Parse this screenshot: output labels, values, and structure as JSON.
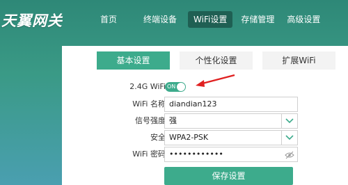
{
  "brand": {
    "logo_text": "天翼网关"
  },
  "nav": {
    "items": [
      {
        "label": "首页"
      },
      {
        "label": "终端设备"
      },
      {
        "label": "WiFi设置"
      },
      {
        "label": "存储管理"
      },
      {
        "label": "高级设置"
      }
    ],
    "active_index": 2
  },
  "tabs": [
    {
      "label": "基本设置"
    },
    {
      "label": "个性化设置"
    },
    {
      "label": "扩展WiFi"
    }
  ],
  "form": {
    "wifi_24g": {
      "label": "2.4G WiFi",
      "toggle_text": "ON",
      "enabled": true
    },
    "ssid": {
      "label": "WiFi 名称",
      "value": "diandian123"
    },
    "signal": {
      "label": "信号强度",
      "value": "强"
    },
    "security": {
      "label": "安全",
      "value": "WPA2-PSK"
    },
    "password": {
      "label": "WiFi 密码",
      "value": "••••••••••••"
    },
    "save_label": "保存设置"
  },
  "colors": {
    "accent": "#3dab8c",
    "nav_active": "#1f5f53",
    "annotation_arrow": "#e02020"
  },
  "icons": {
    "dropdown": "chevron-down-icon",
    "password_toggle": "eye-slash-icon"
  }
}
